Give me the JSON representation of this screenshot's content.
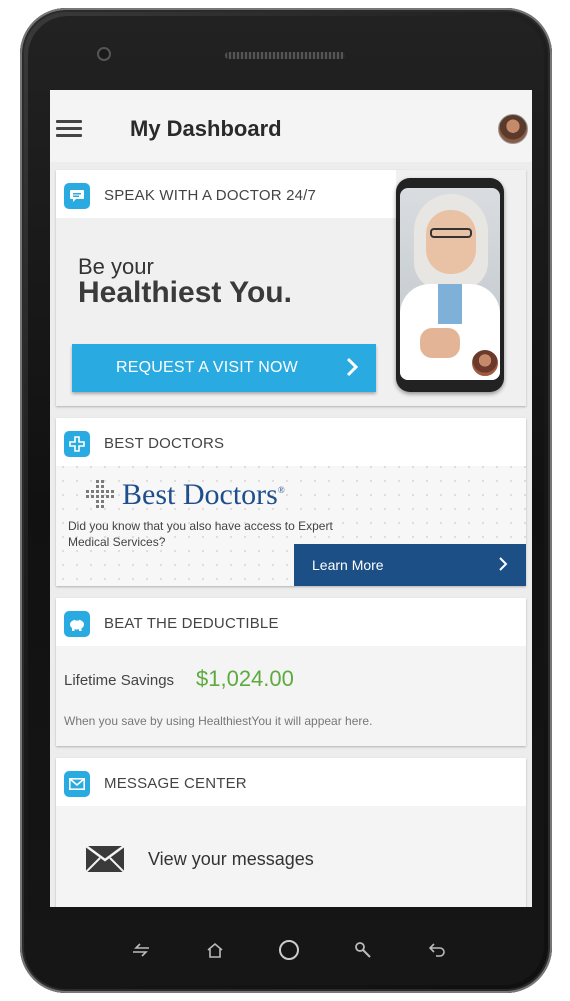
{
  "app_bar": {
    "title": "My Dashboard",
    "menu_icon": "hamburger-menu-icon",
    "avatar_icon": "user-avatar"
  },
  "cards": {
    "speak": {
      "title": "SPEAK WITH A DOCTOR 24/7",
      "icon": "chat-bubble-icon",
      "tagline_small": "Be your",
      "tagline_big": "Healthiest You.",
      "button_label": "REQUEST A VISIT NOW",
      "button_icon": "chevron-right-icon"
    },
    "best_doctors": {
      "title": "BEST DOCTORS",
      "icon": "medical-cross-icon",
      "logo_text": "Best Doctors",
      "logo_mark": "®",
      "description": "Did you know that you also have access to Expert Medical Services?",
      "button_label": "Learn More",
      "button_icon": "chevron-right-icon"
    },
    "deductible": {
      "title": "BEAT THE DEDUCTIBLE",
      "icon": "piggy-bank-icon",
      "savings_label": "Lifetime Savings",
      "savings_value": "$1,024.00",
      "note": "When you save by using HealthiestYou it will appear here."
    },
    "messages": {
      "title": "MESSAGE CENTER",
      "icon": "envelope-icon",
      "row_label": "View your messages",
      "row_icon": "envelope-icon"
    }
  },
  "nav": [
    "recent-apps-icon",
    "home-icon",
    "circle-home-icon",
    "search-icon",
    "back-icon"
  ],
  "colors": {
    "accent": "#29abe2",
    "best_doctors_blue": "#1b4f86",
    "savings_green": "#5dab3e"
  }
}
